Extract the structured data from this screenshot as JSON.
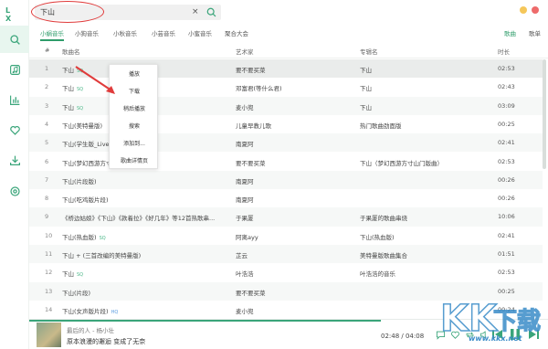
{
  "app": {
    "logo": "L X"
  },
  "colors": {
    "accent": "#3aa57a",
    "annotation": "#e03b3b"
  },
  "search": {
    "value": "下山",
    "clear_icon": "×"
  },
  "sidebar": {
    "items": [
      {
        "icon": "search-icon"
      },
      {
        "icon": "music-note-icon"
      },
      {
        "icon": "chart-icon"
      },
      {
        "icon": "heart-icon"
      },
      {
        "icon": "download-icon"
      },
      {
        "icon": "settings-icon"
      }
    ]
  },
  "source_tabs": [
    "小蜗音乐",
    "小狗音乐",
    "小秋音乐",
    "小芸音乐",
    "小蜜音乐",
    "聚合大会"
  ],
  "type_tabs": [
    "歌曲",
    "歌单"
  ],
  "table": {
    "headers": {
      "num": "#",
      "name": "歌曲名",
      "artist": "艺术家",
      "album": "专辑名",
      "duration": "时长"
    },
    "rows": [
      {
        "num": "1",
        "name": "下山",
        "tag": "SQ",
        "artist": "要不要买菜",
        "album": "下山",
        "duration": "02:53"
      },
      {
        "num": "2",
        "name": "下山",
        "tag": "SQ",
        "artist": "邓富君(等什么君)",
        "album": "下山",
        "duration": "02:43"
      },
      {
        "num": "3",
        "name": "下山",
        "tag": "SQ",
        "artist": "麦小兜",
        "album": "下山",
        "duration": "03:09"
      },
      {
        "num": "4",
        "name": "下山(美特曼版)",
        "tag": "",
        "artist": "儿童早教儿歌",
        "album": "热门歌曲劲面版",
        "duration": "00:25"
      },
      {
        "num": "5",
        "name": "下山(学生版_Live)",
        "tag": "",
        "artist": "南夏阿",
        "album": "",
        "duration": "02:41"
      },
      {
        "num": "6",
        "name": "下山(梦幻西游方寸山门)",
        "tag": "",
        "artist": "要不要买菜",
        "album": "下山（梦幻西游方寸山门版曲）",
        "duration": "02:53"
      },
      {
        "num": "7",
        "name": "下山(片段版)",
        "tag": "",
        "artist": "南夏阿",
        "album": "",
        "duration": "00:26"
      },
      {
        "num": "8",
        "name": "下山(吃鸡版片段)",
        "tag": "",
        "artist": "南夏阿",
        "album": "",
        "duration": "00:26"
      },
      {
        "num": "9",
        "name": "《桥边姑娘》《下山》《款着拉》《好几年》等12首热歌串...",
        "tag": "",
        "artist": "于果厦",
        "album": "于果厦的歌曲串烧",
        "duration": "10:06"
      },
      {
        "num": "10",
        "name": "下山(热血版)",
        "tag": "SQ",
        "artist": "阿离ayy",
        "album": "下山(热血版)",
        "duration": "02:41"
      },
      {
        "num": "11",
        "name": "下山 + (三首改编的美特曼版)",
        "tag": "",
        "artist": "芷云",
        "album": "美特曼版歌曲集合",
        "duration": "01:51"
      },
      {
        "num": "12",
        "name": "下山",
        "tag": "SQ",
        "artist": "叶浩浩",
        "album": "叶浩浩的音乐",
        "duration": "02:53"
      },
      {
        "num": "13",
        "name": "下山(片段)",
        "tag": "",
        "artist": "要不要买菜",
        "album": "",
        "duration": "00:25"
      },
      {
        "num": "14",
        "name": "下山(女声版片段)",
        "tag": "HQ",
        "artist": "麦小兜",
        "album": "",
        "duration": "00:24"
      }
    ]
  },
  "context_menu": {
    "items": [
      "播放",
      "下载",
      "稍后播放",
      "搜索",
      "添加到...",
      "歌曲详情页"
    ]
  },
  "player": {
    "song": "最后的人 - 杨小壮",
    "lyric": "原本浪漫的邂逅 变成了无奈",
    "time": "02:48 / 04:08",
    "progress": 0.677
  },
  "watermark": {
    "text": "www.kkx.net"
  }
}
